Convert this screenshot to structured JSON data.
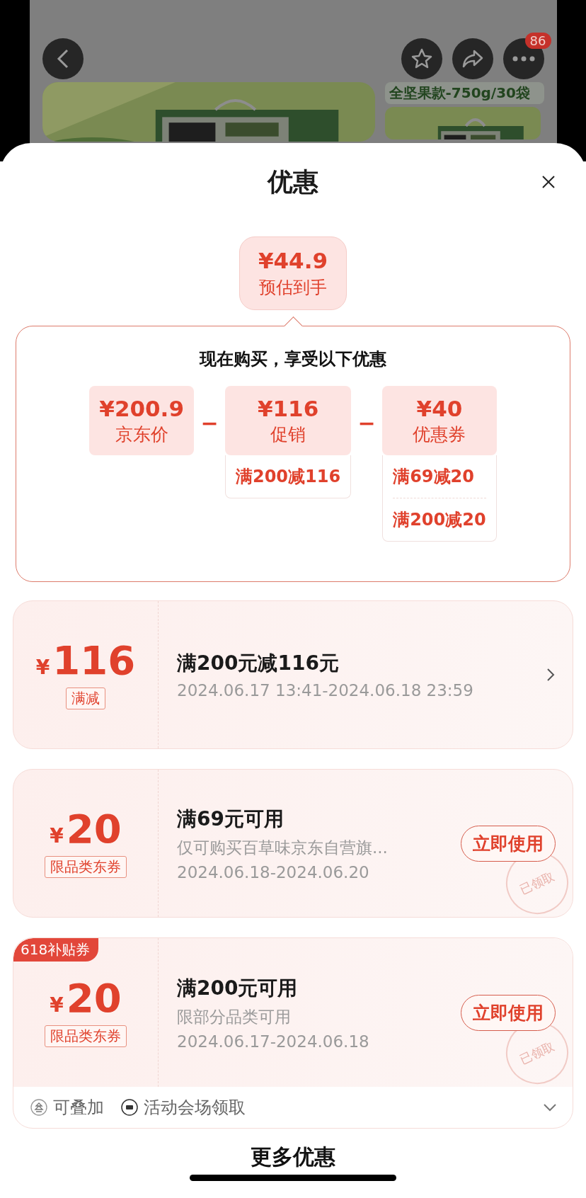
{
  "top_bar": {
    "more_badge": "86",
    "sku_label": "全坚果款-750g/30袋"
  },
  "sheet": {
    "title": "优惠"
  },
  "estimate": {
    "price": "¥44.9",
    "label": "预估到手"
  },
  "breakdown": {
    "title": "现在购买，享受以下优惠",
    "items": [
      {
        "price": "¥200.9",
        "label": "京东价"
      },
      {
        "operator": "−",
        "price": "¥116",
        "label": "促销",
        "details": [
          "满200减116"
        ]
      },
      {
        "operator": "−",
        "price": "¥40",
        "label": "优惠券",
        "details": [
          "满69减20",
          "满200减20"
        ]
      }
    ]
  },
  "coupons": [
    {
      "kind": "promotion",
      "currency": "¥",
      "amount": "116",
      "tag": "满减",
      "title": "满200元减116元",
      "lines": [
        "2024.06.17 13:41-2024.06.18 23:59"
      ]
    },
    {
      "kind": "coupon",
      "currency": "¥",
      "amount": "20",
      "tag": "限品类东券",
      "title": "满69元可用",
      "lines": [
        "仅可购买百草味京东自营旗...",
        "2024.06.18-2024.06.20"
      ],
      "button": "立即使用",
      "stamp": "已领取"
    },
    {
      "kind": "coupon",
      "ribbon": "618补贴券",
      "currency": "¥",
      "amount": "20",
      "tag": "限品类东券",
      "title": "满200元可用",
      "lines": [
        "限部分品类可用",
        "2024.06.17-2024.06.18"
      ],
      "button": "立即使用",
      "stamp": "已领取",
      "footer": [
        {
          "kind": "stackable",
          "label": "可叠加"
        },
        {
          "kind": "venue",
          "label": "活动会场领取"
        }
      ]
    }
  ],
  "more_section": {
    "title": "更多优惠"
  }
}
